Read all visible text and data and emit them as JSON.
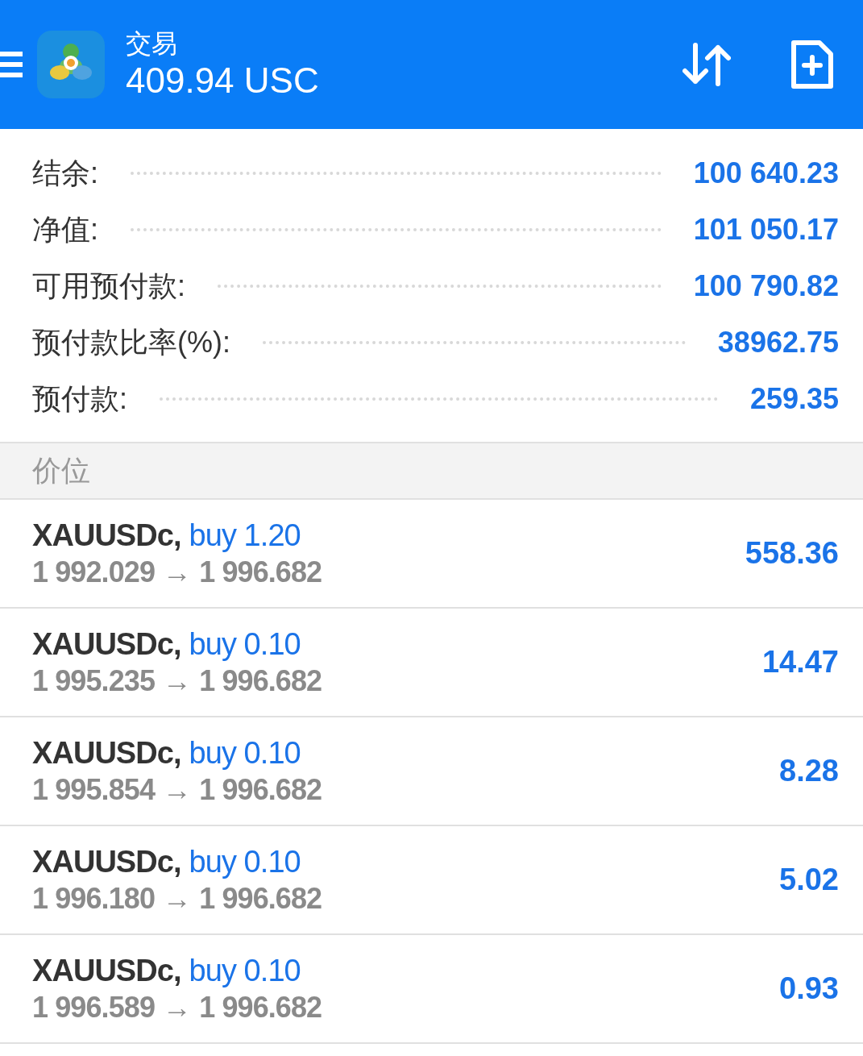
{
  "header": {
    "title": "交易",
    "balance": "409.94 USC"
  },
  "summary": [
    {
      "label": "结余:",
      "value": "100 640.23"
    },
    {
      "label": "净值:",
      "value": "101 050.17"
    },
    {
      "label": "可用预付款:",
      "value": "100 790.82"
    },
    {
      "label": "预付款比率(%):",
      "value": "38962.75"
    },
    {
      "label": "预付款:",
      "value": "259.35"
    }
  ],
  "section": "价位",
  "positions": [
    {
      "symbol": "XAUUSDc,",
      "order": "buy 1.20",
      "open": "1 992.029",
      "arrow": "→",
      "current": "1 996.682",
      "profit": "558.36"
    },
    {
      "symbol": "XAUUSDc,",
      "order": "buy 0.10",
      "open": "1 995.235",
      "arrow": "→",
      "current": "1 996.682",
      "profit": "14.47"
    },
    {
      "symbol": "XAUUSDc,",
      "order": "buy 0.10",
      "open": "1 995.854",
      "arrow": "→",
      "current": "1 996.682",
      "profit": "8.28"
    },
    {
      "symbol": "XAUUSDc,",
      "order": "buy 0.10",
      "open": "1 996.180",
      "arrow": "→",
      "current": "1 996.682",
      "profit": "5.02"
    },
    {
      "symbol": "XAUUSDc,",
      "order": "buy 0.10",
      "open": "1 996.589",
      "arrow": "→",
      "current": "1 996.682",
      "profit": "0.93"
    }
  ]
}
